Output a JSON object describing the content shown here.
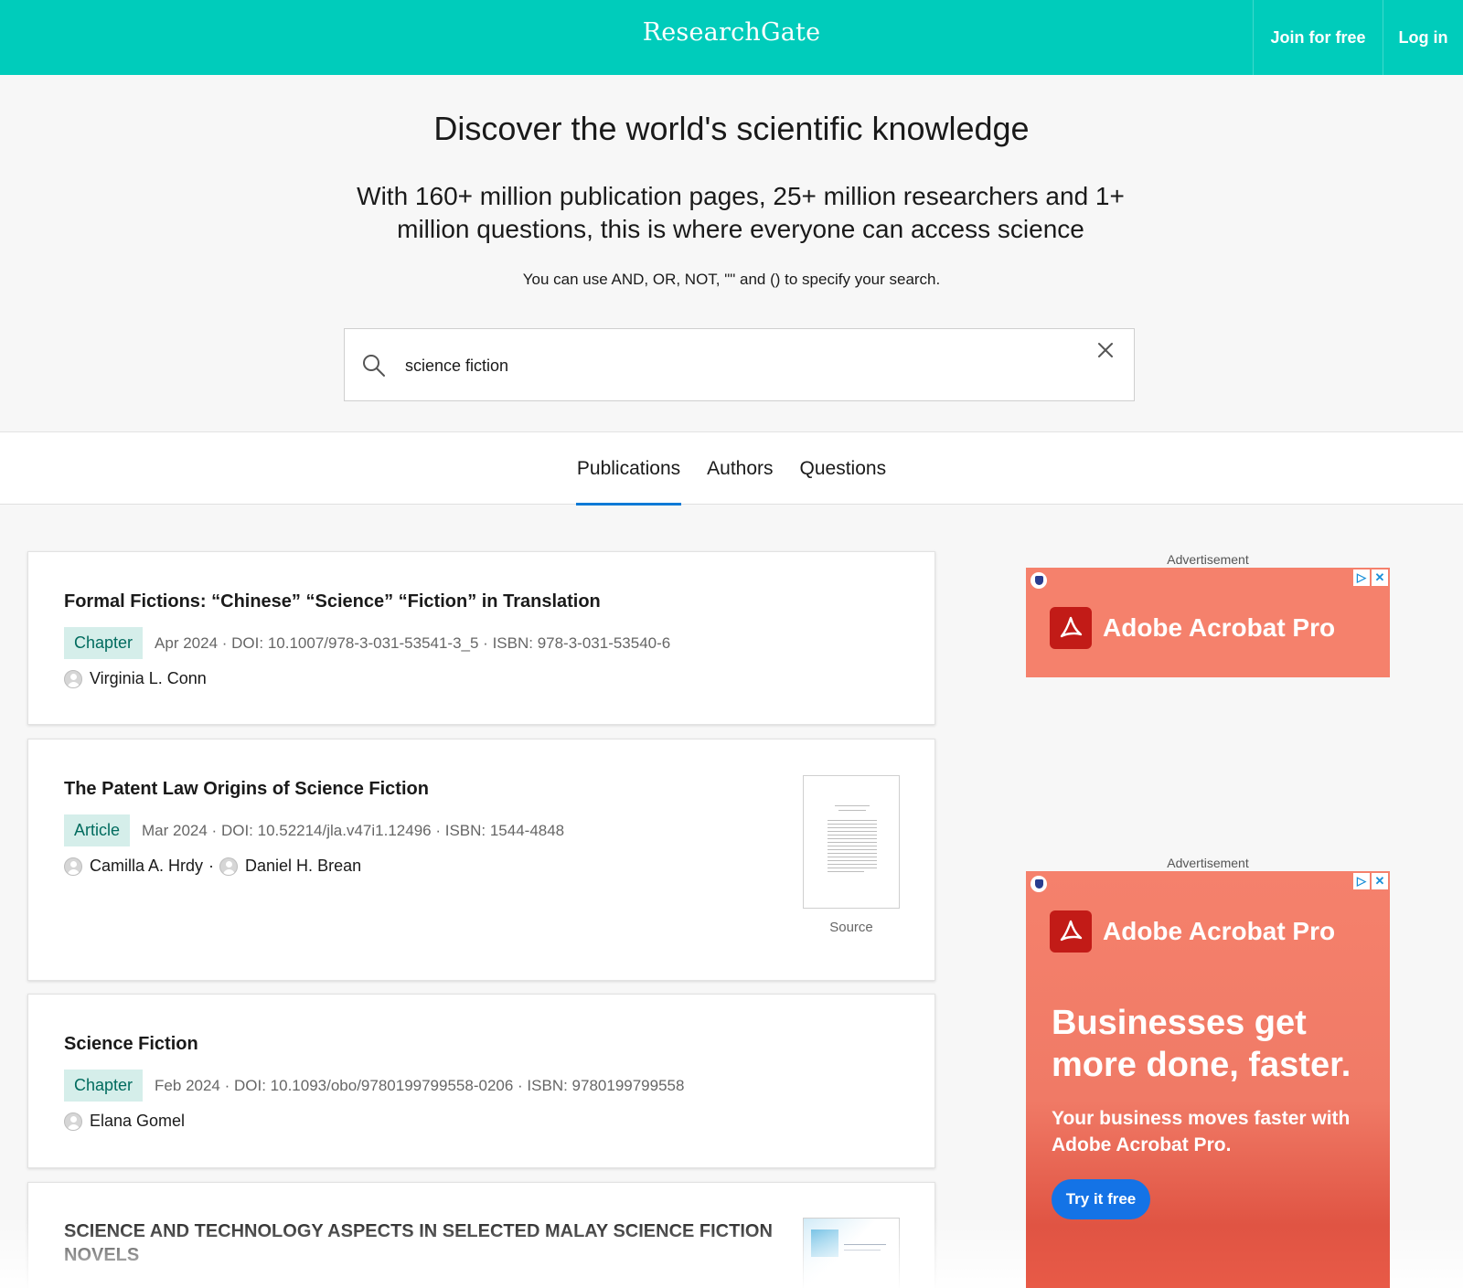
{
  "header": {
    "brand": "ResearchGate",
    "join_label": "Join for free",
    "login_label": "Log in"
  },
  "hero": {
    "title": "Discover the world's scientific knowledge",
    "subtitle": "With 160+ million publication pages, 25+ million researchers and 1+ million questions, this is where everyone can access science",
    "hint": "You can use AND, OR, NOT, \"\" and () to specify your search.",
    "search_value": "science fiction"
  },
  "tabs": [
    {
      "label": "Publications",
      "active": true
    },
    {
      "label": "Authors",
      "active": false
    },
    {
      "label": "Questions",
      "active": false
    }
  ],
  "results": [
    {
      "title": "Formal Fictions: “Chinese” “Science” “Fiction” in Translation",
      "type": "Chapter",
      "meta": "Apr 2024 · DOI: 10.1007/978-3-031-53541-3_5 · ISBN: 978-3-031-53540-6",
      "authors": [
        "Virginia L. Conn"
      ]
    },
    {
      "title": "The Patent Law Origins of Science Fiction",
      "type": "Article",
      "meta": "Mar 2024 · DOI: 10.52214/jla.v47i1.12496 · ISBN: 1544-4848",
      "authors": [
        "Camilla A. Hrdy",
        "Daniel H. Brean"
      ],
      "source_label": "Source"
    },
    {
      "title": "Science Fiction",
      "type": "Chapter",
      "meta": "Feb 2024 · DOI: 10.1093/obo/9780199799558-0206 · ISBN: 9780199799558",
      "authors": [
        "Elana Gomel"
      ]
    },
    {
      "title_line1": "SCIENCE AND TECHNOLOGY ASPECTS IN SELECTED MALAY SCIENCE FICTION",
      "title_line2": "NOVELS"
    }
  ],
  "ads": [
    {
      "label": "Advertisement",
      "brand": "Adobe Acrobat Pro"
    },
    {
      "label": "Advertisement",
      "brand": "Adobe Acrobat Pro",
      "headline": "Businesses get more done, faster.",
      "body": "Your business moves faster with Adobe Acrobat Pro.",
      "cta": "Try it free"
    }
  ],
  "colors": {
    "brand": "#00ccbb",
    "tab_active": "#0e7ad6",
    "badge_bg": "#d5eeea",
    "badge_text": "#006b5e",
    "ad_bg": "#f5816c",
    "ad_cta": "#1473e6"
  },
  "icons": {
    "search": "search-icon",
    "clear": "close-icon",
    "avatar": "user-avatar-icon",
    "adchoices": "adchoices-icon",
    "ad_close": "close-icon",
    "acrobat": "acrobat-logo-icon"
  }
}
